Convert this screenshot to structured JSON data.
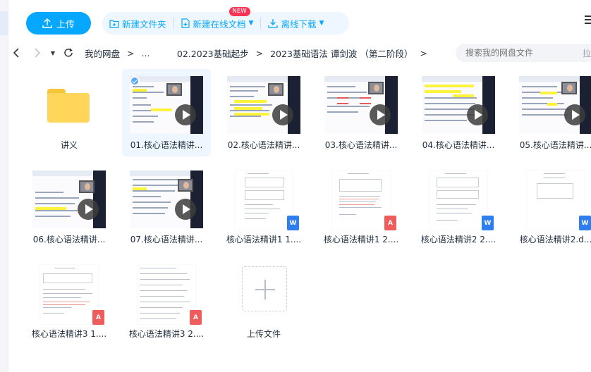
{
  "toolbar": {
    "upload_label": "上传",
    "new_folder_label": "新建文件夹",
    "new_online_doc_label": "新建在线文档",
    "new_badge": "NEW",
    "offline_download_label": "离线下载"
  },
  "nav": {
    "breadcrumbs": [
      "我的网盘",
      "...",
      "02.2023基础起步",
      "2023基础语法 谭剑波 （第二阶段）"
    ],
    "search_placeholder": "搜索我的网盘文件",
    "search_extra": "拉"
  },
  "files": [
    {
      "name": "讲义",
      "type": "folder"
    },
    {
      "name": "01.核心语法精讲...",
      "type": "video",
      "selected": true
    },
    {
      "name": "02.核心语法精讲...",
      "type": "video"
    },
    {
      "name": "03.核心语法精讲...",
      "type": "video"
    },
    {
      "name": "04.核心语法精讲...",
      "type": "video"
    },
    {
      "name": "05.核心语法精讲...",
      "type": "video"
    },
    {
      "name": "06.核心语法精讲...",
      "type": "video"
    },
    {
      "name": "07.核心语法精讲...",
      "type": "video"
    },
    {
      "name": "核心语法精讲1 1....",
      "type": "word"
    },
    {
      "name": "核心语法精讲1 2....",
      "type": "pdf"
    },
    {
      "name": "核心语法精讲2 2....",
      "type": "word"
    },
    {
      "name": "核心语法精讲2.d...",
      "type": "word"
    },
    {
      "name": "核心语法精讲3 1....",
      "type": "pdf"
    },
    {
      "name": "核心语法精讲3 2....",
      "type": "pdf"
    },
    {
      "name": "上传文件",
      "type": "upload"
    }
  ],
  "badges": {
    "word": "W",
    "pdf": "A"
  },
  "colors": {
    "accent": "#06a7ff",
    "folder": "#ffd55a",
    "word": "#2e7ef0",
    "pdf": "#ef5c5c"
  }
}
